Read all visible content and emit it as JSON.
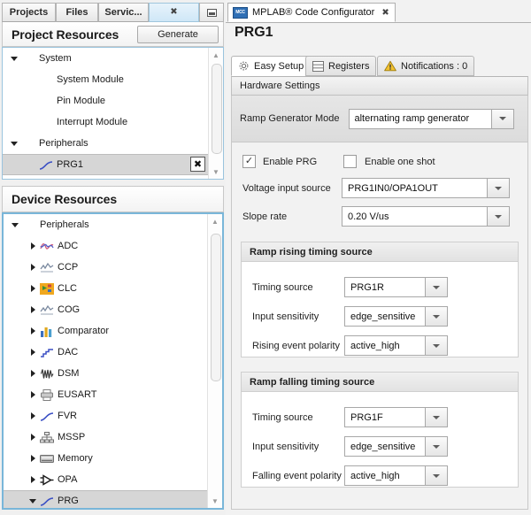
{
  "left": {
    "tabs": [
      {
        "label": "Projects",
        "active": false
      },
      {
        "label": "Files",
        "active": false
      },
      {
        "label": "Servic...",
        "active": false
      }
    ],
    "tab_close_icon": "close-icon",
    "tab_minimize_icon": "minimize-icon",
    "project_resources": {
      "title": "Project Resources",
      "generate_label": "Generate",
      "tree": [
        {
          "label": "System",
          "indent": 0,
          "twisty": "down",
          "icon": "",
          "selected": false
        },
        {
          "label": "System Module",
          "indent": 1,
          "twisty": "none",
          "icon": "",
          "selected": false
        },
        {
          "label": "Pin Module",
          "indent": 1,
          "twisty": "none",
          "icon": "",
          "selected": false
        },
        {
          "label": "Interrupt Module",
          "indent": 1,
          "twisty": "none",
          "icon": "",
          "selected": false
        },
        {
          "label": "Peripherals",
          "indent": 0,
          "twisty": "down",
          "icon": "",
          "selected": false
        },
        {
          "label": "PRG1",
          "indent": 1,
          "twisty": "none",
          "icon": "ramp-icon",
          "selected": true,
          "remove_icon": "close-icon"
        }
      ]
    },
    "device_resources": {
      "title": "Device Resources",
      "tree": [
        {
          "label": "Peripherals",
          "indent": 0,
          "twisty": "down",
          "icon": "",
          "selected": false
        },
        {
          "label": "ADC",
          "indent": 1,
          "twisty": "right",
          "icon": "adc-icon",
          "selected": false
        },
        {
          "label": "CCP",
          "indent": 1,
          "twisty": "right",
          "icon": "waveform-icon",
          "selected": false
        },
        {
          "label": "CLC",
          "indent": 1,
          "twisty": "right",
          "icon": "logic-icon",
          "selected": false
        },
        {
          "label": "COG",
          "indent": 1,
          "twisty": "right",
          "icon": "waveform-icon",
          "selected": false
        },
        {
          "label": "Comparator",
          "indent": 1,
          "twisty": "right",
          "icon": "bars-icon",
          "selected": false
        },
        {
          "label": "DAC",
          "indent": 1,
          "twisty": "right",
          "icon": "staircase-icon",
          "selected": false
        },
        {
          "label": "DSM",
          "indent": 1,
          "twisty": "right",
          "icon": "modulation-icon",
          "selected": false
        },
        {
          "label": "EUSART",
          "indent": 1,
          "twisty": "right",
          "icon": "serial-icon",
          "selected": false
        },
        {
          "label": "FVR",
          "indent": 1,
          "twisty": "right",
          "icon": "ramp-icon",
          "selected": false
        },
        {
          "label": "MSSP",
          "indent": 1,
          "twisty": "right",
          "icon": "network-icon",
          "selected": false
        },
        {
          "label": "Memory",
          "indent": 1,
          "twisty": "right",
          "icon": "memory-icon",
          "selected": false
        },
        {
          "label": "OPA",
          "indent": 1,
          "twisty": "right",
          "icon": "opamp-icon",
          "selected": false
        },
        {
          "label": "PRG",
          "indent": 1,
          "twisty": "down",
          "icon": "ramp-icon",
          "selected": true
        }
      ]
    }
  },
  "right": {
    "window_tab": {
      "label": "MPLAB® Code Configurator",
      "icon_text": "MCC",
      "close_icon": "close-icon"
    },
    "page_title": "PRG1",
    "sub_tabs": [
      {
        "label": "Easy Setup",
        "icon": "gear-icon",
        "active": true
      },
      {
        "label": "Registers",
        "icon": "registers-icon",
        "active": false
      },
      {
        "label": "Notifications : 0",
        "icon": "warning-icon",
        "active": false
      }
    ],
    "hardware_settings_label": "Hardware Settings",
    "ramp_generator_mode": {
      "label": "Ramp Generator Mode",
      "value": "alternating ramp generator"
    },
    "enable_prg": {
      "label": "Enable PRG",
      "checked": true,
      "check_glyph": "✓"
    },
    "enable_one_shot": {
      "label": "Enable one shot",
      "checked": false,
      "check_glyph": ""
    },
    "voltage_input_source": {
      "label": "Voltage input source",
      "value": "PRG1IN0/OPA1OUT"
    },
    "slope_rate": {
      "label": "Slope rate",
      "value": "0.20 V/us"
    },
    "ramp_rising": {
      "title": "Ramp rising timing source",
      "rows": [
        {
          "label": "Timing source",
          "value": "PRG1R"
        },
        {
          "label": "Input sensitivity",
          "value": "edge_sensitive"
        },
        {
          "label": "Rising event polarity",
          "value": "active_high"
        }
      ]
    },
    "ramp_falling": {
      "title": "Ramp falling timing source",
      "rows": [
        {
          "label": "Timing source",
          "value": "PRG1F"
        },
        {
          "label": "Input sensitivity",
          "value": "edge_sensitive"
        },
        {
          "label": "Falling event polarity",
          "value": "active_high"
        }
      ]
    }
  },
  "colors": {
    "accent_blue": "#2f6fb5",
    "selection_gray": "#d6d6d6",
    "tree_border": "#79b6d9",
    "warning_yellow": "#f2c12e"
  }
}
